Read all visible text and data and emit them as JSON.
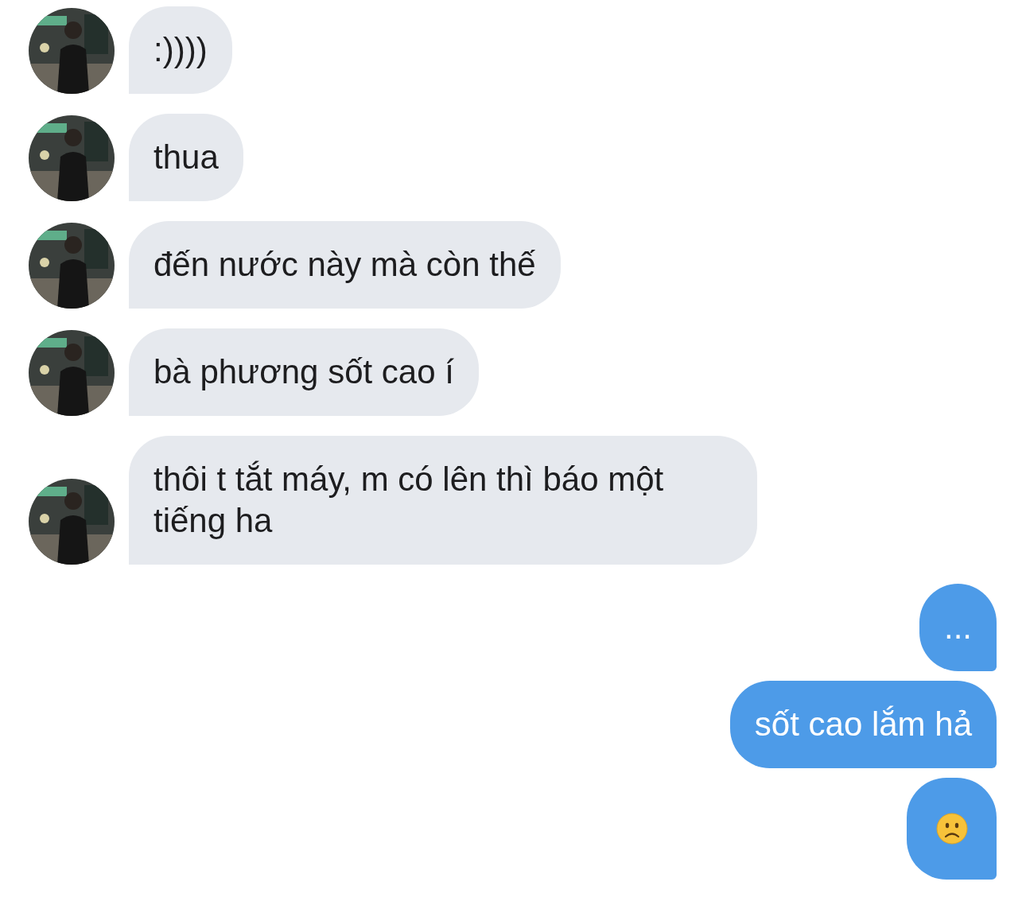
{
  "messages": [
    {
      "sent": false,
      "kind": "text",
      "text": ":))))"
    },
    {
      "sent": false,
      "kind": "text",
      "text": "thua"
    },
    {
      "sent": false,
      "kind": "text",
      "text": "đến nước này mà còn thế"
    },
    {
      "sent": false,
      "kind": "text",
      "text": "bà phương sốt cao í"
    },
    {
      "sent": false,
      "kind": "text",
      "text": "thôi t tắt máy, m có lên thì báo một tiếng ha"
    },
    {
      "sent": true,
      "kind": "text",
      "text": "..."
    },
    {
      "sent": true,
      "kind": "text",
      "text": "sốt cao lắm hả"
    },
    {
      "sent": true,
      "kind": "emoji"
    }
  ]
}
